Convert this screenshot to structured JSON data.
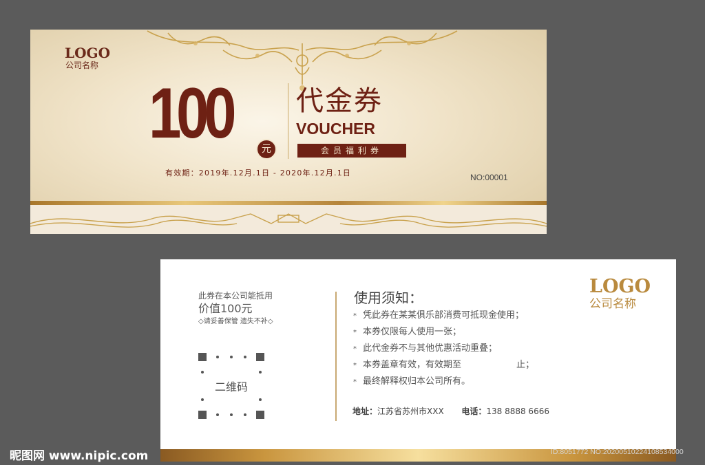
{
  "front": {
    "logo_text": "LOGO",
    "company_name": "公司名称",
    "amount": "100",
    "currency": "元",
    "title_cn": "代金券",
    "title_en": "VOUCHER",
    "member_label": "会员福利券",
    "validity": "有效期：2019年.12月.1日 - 2020年.12月.1日",
    "serial": "NO:00001"
  },
  "back": {
    "worth_line": "此券在本公司能抵用",
    "value_line": "价值100元",
    "keep_line": "◇请妥善保管 遗失不补◇",
    "qr_label": "二维码",
    "notice_title": "使用须知：",
    "notices": [
      "凭此券在某某俱乐部消费可抵现金使用；",
      "本券仅限每人使用一张；",
      "此代金券不与其他优惠活动重叠；",
      "本券盖章有效，有效期至"
    ],
    "notice_4_suffix": "止；",
    "notice_5": "最终解释权归本公司所有。",
    "address_label": "地址：",
    "address": "江苏省苏州市XXX",
    "phone_label": "电话：",
    "phone": "138 8888 6666",
    "logo_text": "LOGO",
    "company_name": "公司名称"
  },
  "watermark": {
    "site": "昵图网 www.nipic.com",
    "id": "ID:8051772 NO:20200510224108534000"
  },
  "colors": {
    "brand_brown": "#6e2114",
    "gold": "#c9a765",
    "background": "#5b5b5b"
  }
}
